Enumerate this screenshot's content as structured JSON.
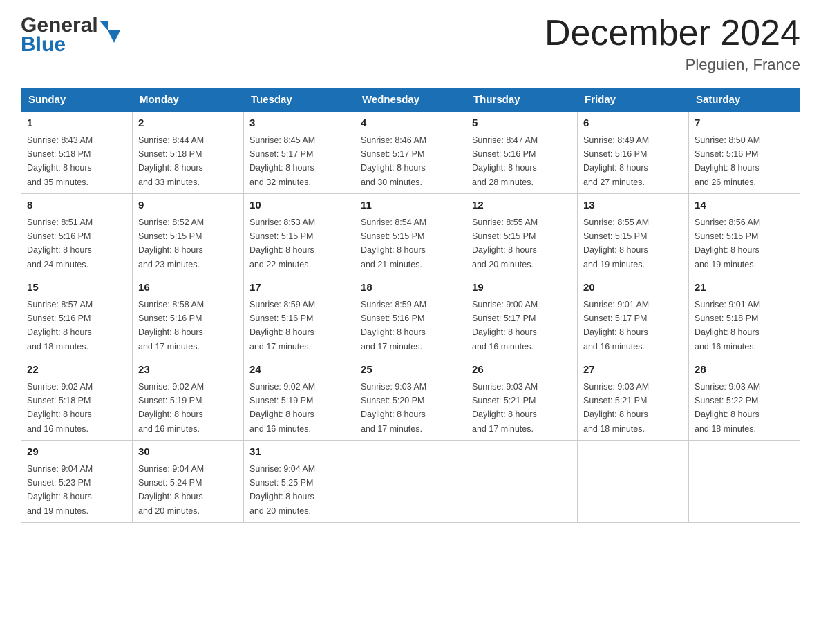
{
  "header": {
    "title": "December 2024",
    "location": "Pleguien, France",
    "logo_general": "General",
    "logo_blue": "Blue"
  },
  "weekdays": [
    "Sunday",
    "Monday",
    "Tuesday",
    "Wednesday",
    "Thursday",
    "Friday",
    "Saturday"
  ],
  "weeks": [
    [
      {
        "day": "1",
        "sunrise": "8:43 AM",
        "sunset": "5:18 PM",
        "daylight": "8 hours and 35 minutes."
      },
      {
        "day": "2",
        "sunrise": "8:44 AM",
        "sunset": "5:18 PM",
        "daylight": "8 hours and 33 minutes."
      },
      {
        "day": "3",
        "sunrise": "8:45 AM",
        "sunset": "5:17 PM",
        "daylight": "8 hours and 32 minutes."
      },
      {
        "day": "4",
        "sunrise": "8:46 AM",
        "sunset": "5:17 PM",
        "daylight": "8 hours and 30 minutes."
      },
      {
        "day": "5",
        "sunrise": "8:47 AM",
        "sunset": "5:16 PM",
        "daylight": "8 hours and 28 minutes."
      },
      {
        "day": "6",
        "sunrise": "8:49 AM",
        "sunset": "5:16 PM",
        "daylight": "8 hours and 27 minutes."
      },
      {
        "day": "7",
        "sunrise": "8:50 AM",
        "sunset": "5:16 PM",
        "daylight": "8 hours and 26 minutes."
      }
    ],
    [
      {
        "day": "8",
        "sunrise": "8:51 AM",
        "sunset": "5:16 PM",
        "daylight": "8 hours and 24 minutes."
      },
      {
        "day": "9",
        "sunrise": "8:52 AM",
        "sunset": "5:15 PM",
        "daylight": "8 hours and 23 minutes."
      },
      {
        "day": "10",
        "sunrise": "8:53 AM",
        "sunset": "5:15 PM",
        "daylight": "8 hours and 22 minutes."
      },
      {
        "day": "11",
        "sunrise": "8:54 AM",
        "sunset": "5:15 PM",
        "daylight": "8 hours and 21 minutes."
      },
      {
        "day": "12",
        "sunrise": "8:55 AM",
        "sunset": "5:15 PM",
        "daylight": "8 hours and 20 minutes."
      },
      {
        "day": "13",
        "sunrise": "8:55 AM",
        "sunset": "5:15 PM",
        "daylight": "8 hours and 19 minutes."
      },
      {
        "day": "14",
        "sunrise": "8:56 AM",
        "sunset": "5:15 PM",
        "daylight": "8 hours and 19 minutes."
      }
    ],
    [
      {
        "day": "15",
        "sunrise": "8:57 AM",
        "sunset": "5:16 PM",
        "daylight": "8 hours and 18 minutes."
      },
      {
        "day": "16",
        "sunrise": "8:58 AM",
        "sunset": "5:16 PM",
        "daylight": "8 hours and 17 minutes."
      },
      {
        "day": "17",
        "sunrise": "8:59 AM",
        "sunset": "5:16 PM",
        "daylight": "8 hours and 17 minutes."
      },
      {
        "day": "18",
        "sunrise": "8:59 AM",
        "sunset": "5:16 PM",
        "daylight": "8 hours and 17 minutes."
      },
      {
        "day": "19",
        "sunrise": "9:00 AM",
        "sunset": "5:17 PM",
        "daylight": "8 hours and 16 minutes."
      },
      {
        "day": "20",
        "sunrise": "9:01 AM",
        "sunset": "5:17 PM",
        "daylight": "8 hours and 16 minutes."
      },
      {
        "day": "21",
        "sunrise": "9:01 AM",
        "sunset": "5:18 PM",
        "daylight": "8 hours and 16 minutes."
      }
    ],
    [
      {
        "day": "22",
        "sunrise": "9:02 AM",
        "sunset": "5:18 PM",
        "daylight": "8 hours and 16 minutes."
      },
      {
        "day": "23",
        "sunrise": "9:02 AM",
        "sunset": "5:19 PM",
        "daylight": "8 hours and 16 minutes."
      },
      {
        "day": "24",
        "sunrise": "9:02 AM",
        "sunset": "5:19 PM",
        "daylight": "8 hours and 16 minutes."
      },
      {
        "day": "25",
        "sunrise": "9:03 AM",
        "sunset": "5:20 PM",
        "daylight": "8 hours and 17 minutes."
      },
      {
        "day": "26",
        "sunrise": "9:03 AM",
        "sunset": "5:21 PM",
        "daylight": "8 hours and 17 minutes."
      },
      {
        "day": "27",
        "sunrise": "9:03 AM",
        "sunset": "5:21 PM",
        "daylight": "8 hours and 18 minutes."
      },
      {
        "day": "28",
        "sunrise": "9:03 AM",
        "sunset": "5:22 PM",
        "daylight": "8 hours and 18 minutes."
      }
    ],
    [
      {
        "day": "29",
        "sunrise": "9:04 AM",
        "sunset": "5:23 PM",
        "daylight": "8 hours and 19 minutes."
      },
      {
        "day": "30",
        "sunrise": "9:04 AM",
        "sunset": "5:24 PM",
        "daylight": "8 hours and 20 minutes."
      },
      {
        "day": "31",
        "sunrise": "9:04 AM",
        "sunset": "5:25 PM",
        "daylight": "8 hours and 20 minutes."
      },
      null,
      null,
      null,
      null
    ]
  ],
  "labels": {
    "sunrise": "Sunrise:",
    "sunset": "Sunset:",
    "daylight": "Daylight:"
  }
}
